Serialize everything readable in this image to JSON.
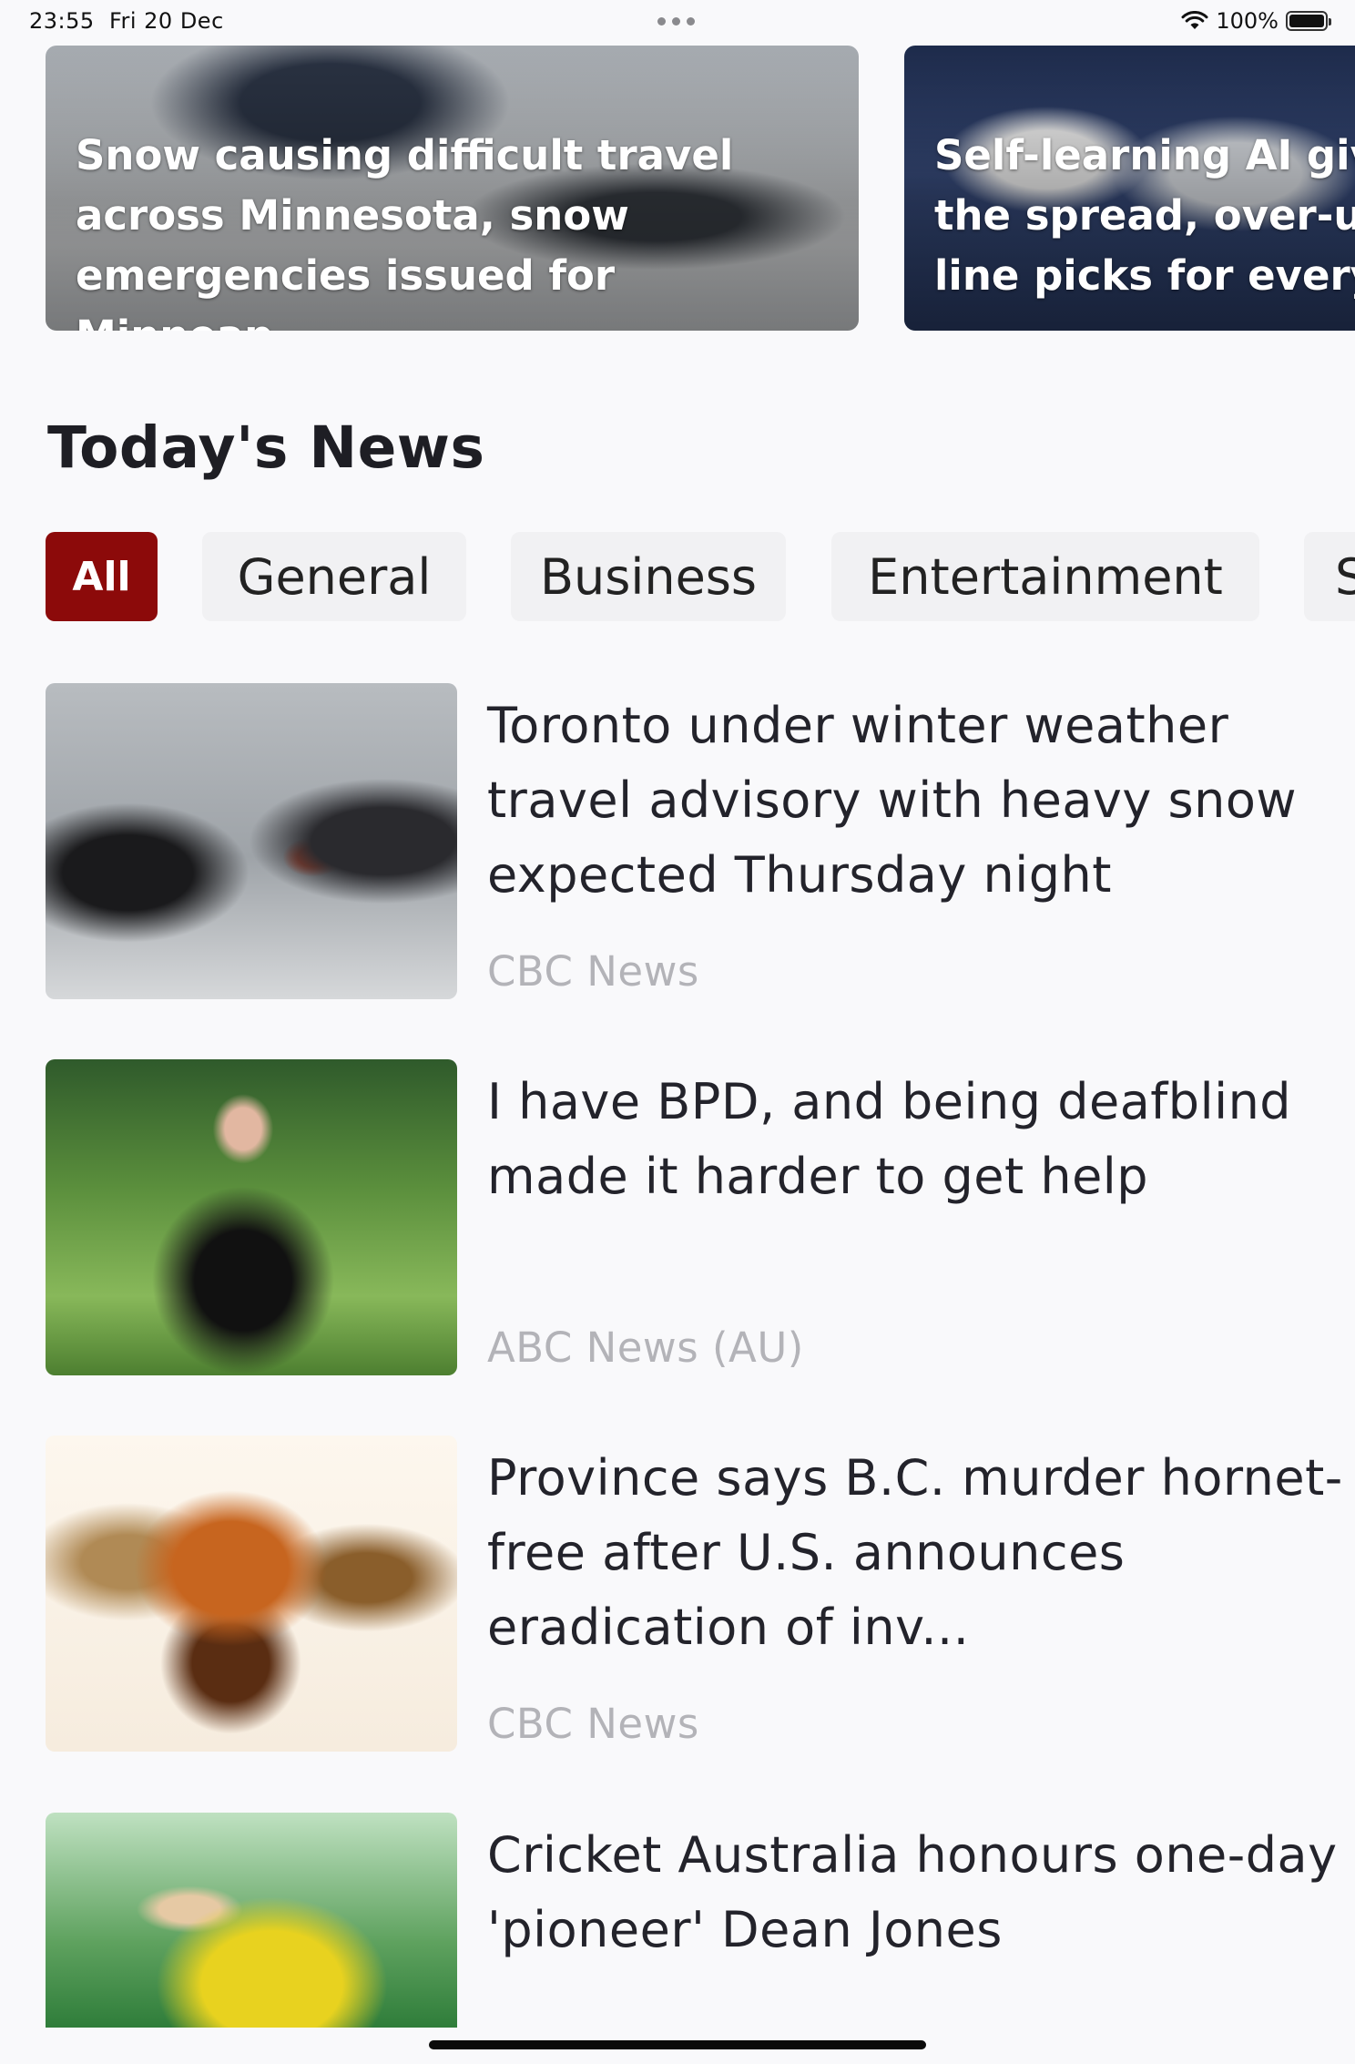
{
  "status_bar": {
    "time": "23:55",
    "date": "Fri 20 Dec",
    "battery": "100%"
  },
  "featured": [
    {
      "title": "Snow causing difficult travel\nacross Minnesota, snow\nemergencies issued for Minneap..."
    },
    {
      "title": "Self-learning AI give\nthe spread, over-un\nline picks for every"
    }
  ],
  "section_title": "Today's News",
  "categories": [
    "All",
    "General",
    "Business",
    "Entertainment",
    "S"
  ],
  "active_category": "All",
  "news": [
    {
      "headline": "Toronto under winter weather travel advisory with heavy snow expected Thursday night",
      "source": "CBC News"
    },
    {
      "headline": "I have BPD, and being deafblind made it harder to get help",
      "source": "ABC News (AU)"
    },
    {
      "headline": "Province says B.C. murder hornet-free after U.S. announces eradication of inv...",
      "source": "CBC News"
    },
    {
      "headline": "Cricket Australia honours one-day 'pioneer' Dean Jones",
      "source": ""
    }
  ],
  "colors": {
    "accent": "#8c0a0a",
    "background": "#f9f9fb",
    "chip_background": "#f1f1f3",
    "source_text": "#b3b3b8"
  },
  "icons": [
    "wifi-icon",
    "battery-icon",
    "multitasking-dots-icon"
  ]
}
